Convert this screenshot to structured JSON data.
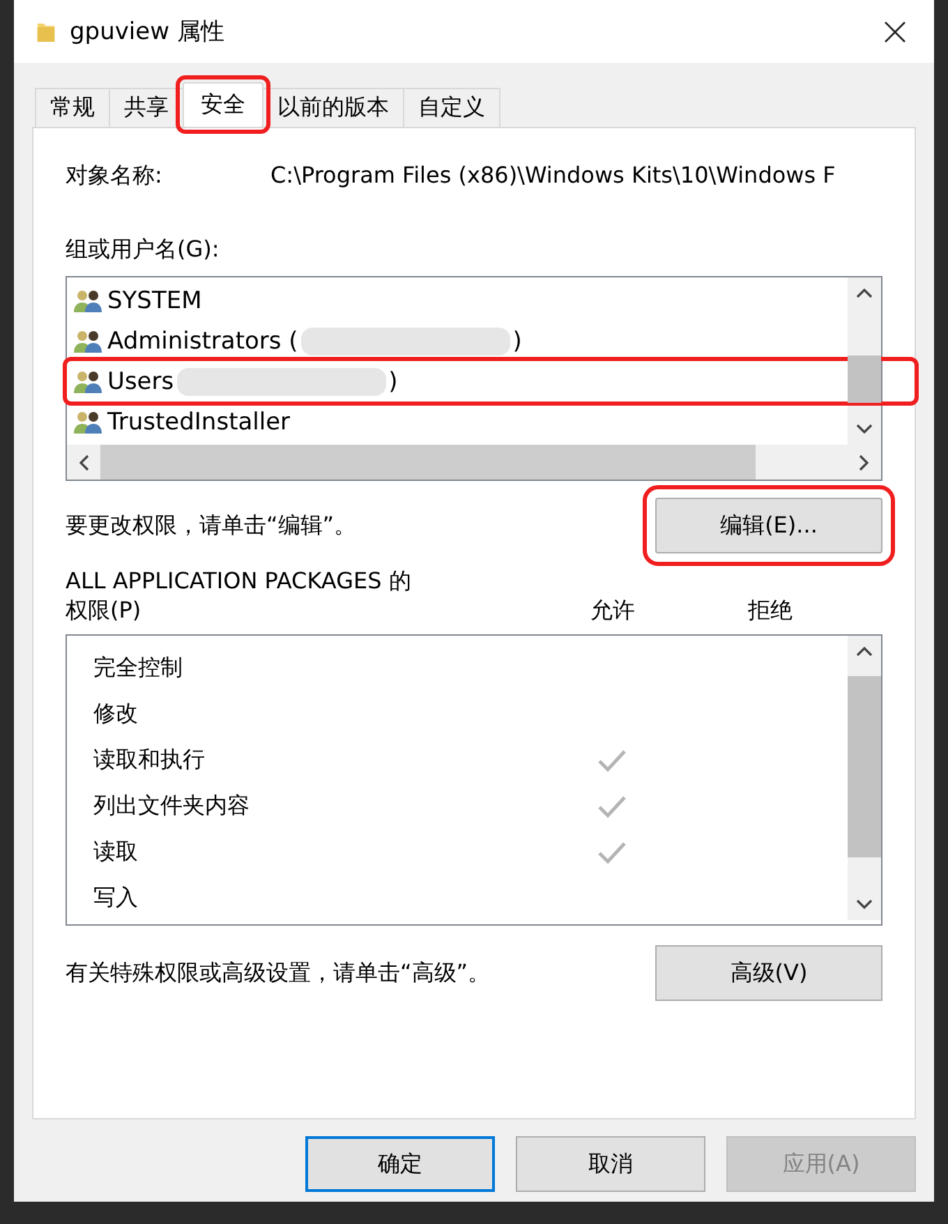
{
  "window": {
    "title": "gpuview 属性"
  },
  "tabs": [
    {
      "label": "常规",
      "selected": false,
      "annotated": false
    },
    {
      "label": "共享",
      "selected": false,
      "annotated": false
    },
    {
      "label": "安全",
      "selected": true,
      "annotated": true
    },
    {
      "label": "以前的版本",
      "selected": false,
      "annotated": false
    },
    {
      "label": "自定义",
      "selected": false,
      "annotated": false
    }
  ],
  "object": {
    "label": "对象名称:",
    "value": "C:\\Program Files (x86)\\Windows Kits\\10\\Windows F"
  },
  "groups": {
    "label": "组或用户名(G):",
    "items": [
      {
        "name": "SYSTEM",
        "redacted": false,
        "annotated": false
      },
      {
        "name": "Administrators (",
        "suffix": ")",
        "redacted": true,
        "annotated": false
      },
      {
        "name": "Users",
        "suffix": ")",
        "redacted": true,
        "annotated": true
      },
      {
        "name": "TrustedInstaller",
        "redacted": false,
        "annotated": false
      }
    ]
  },
  "edit": {
    "hint": "要更改权限，请单击“编辑”。",
    "button": "编辑(E)...",
    "annotated": true
  },
  "permissions": {
    "title": "ALL APPLICATION PACKAGES 的",
    "label": "权限(P)",
    "allow_header": "允许",
    "deny_header": "拒绝",
    "rows": [
      {
        "name": "完全控制",
        "allow": false
      },
      {
        "name": "修改",
        "allow": false
      },
      {
        "name": "读取和执行",
        "allow": true
      },
      {
        "name": "列出文件夹内容",
        "allow": true
      },
      {
        "name": "读取",
        "allow": true
      },
      {
        "name": "写入",
        "allow": false
      }
    ]
  },
  "advanced": {
    "hint": "有关特殊权限或高级设置，请单击“高级”。",
    "button": "高级(V)"
  },
  "buttons": [
    {
      "label": "确定",
      "kind": "default",
      "disabled": false
    },
    {
      "label": "取消",
      "kind": "normal",
      "disabled": false
    },
    {
      "label": "应用(A)",
      "kind": "normal",
      "disabled": true
    }
  ]
}
